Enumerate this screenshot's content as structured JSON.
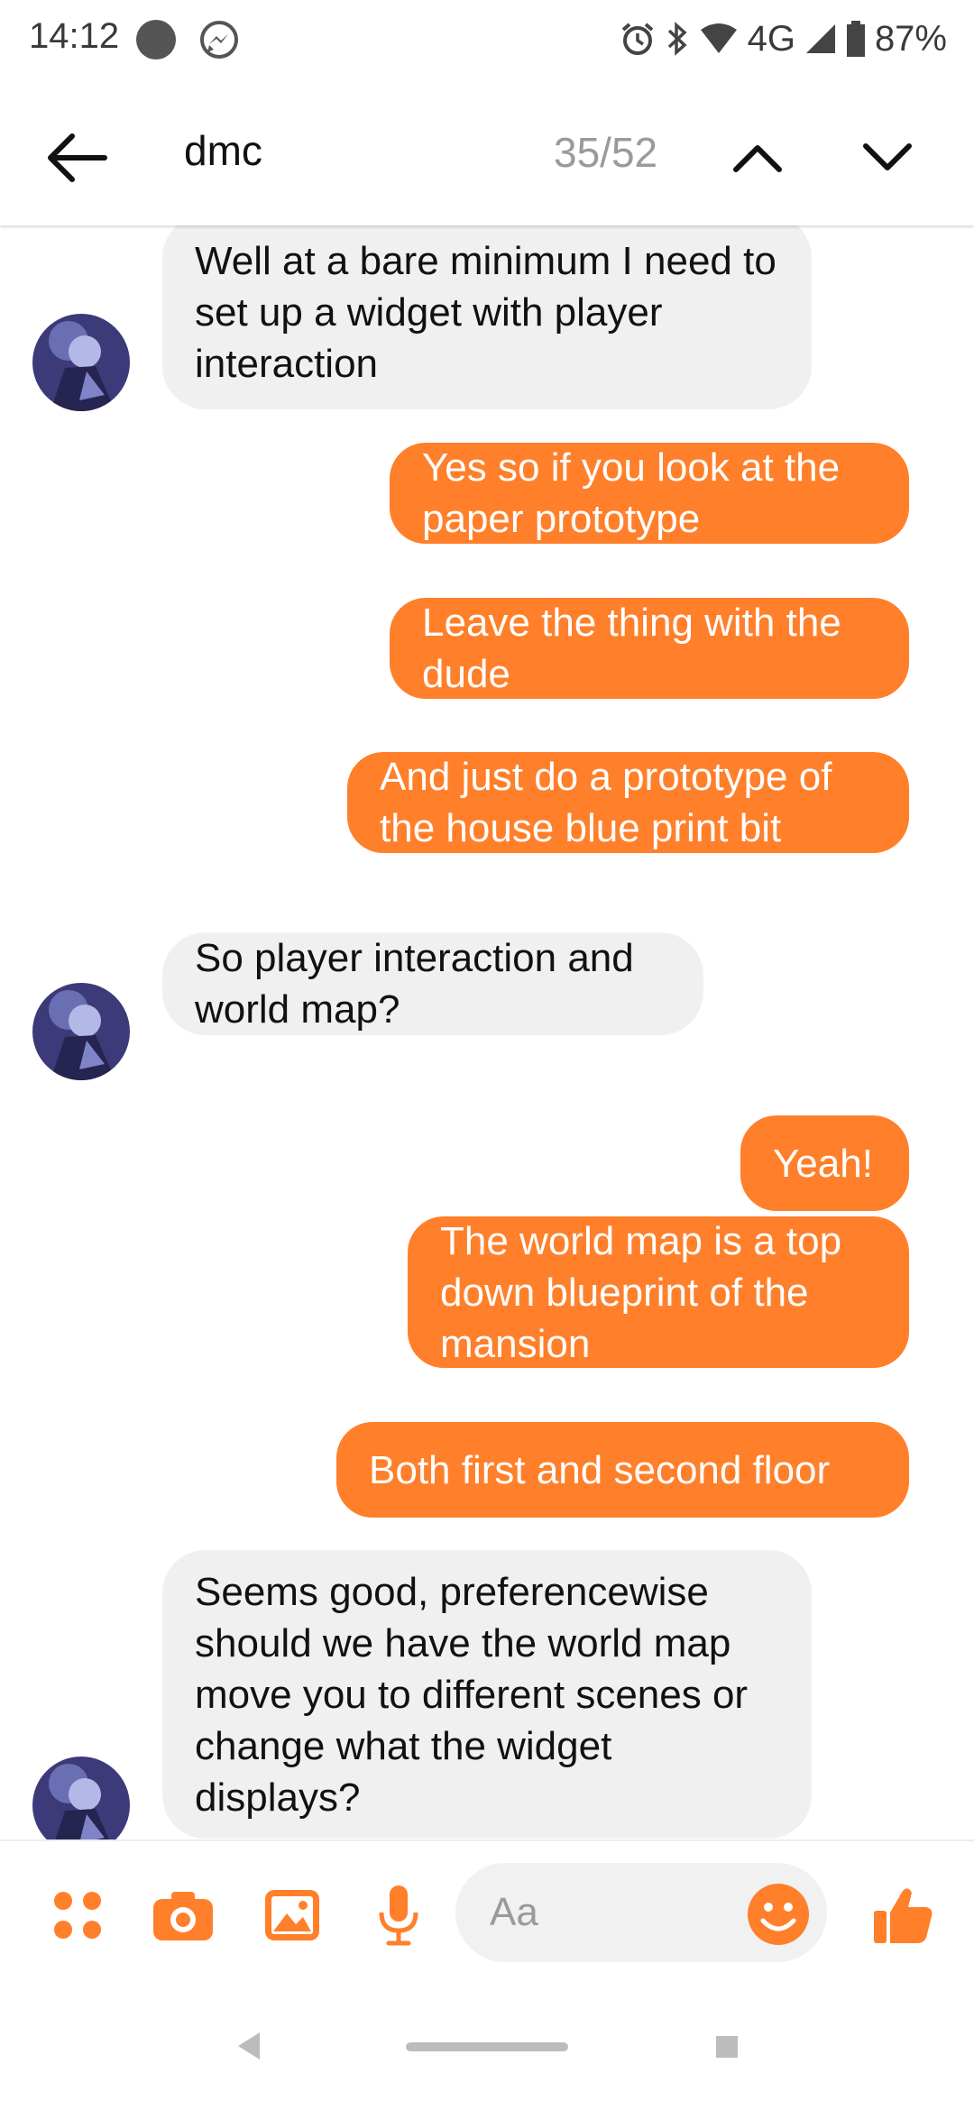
{
  "status_bar": {
    "time": "14:12",
    "network": "4G",
    "battery": "87%",
    "icons": [
      "notification-dot-icon",
      "messenger-icon",
      "alarm-icon",
      "bluetooth-icon",
      "wifi-icon",
      "signal-icon",
      "battery-icon"
    ]
  },
  "search": {
    "query": "dmc",
    "match_count": "35/52",
    "icons": [
      "back-arrow-icon",
      "chevron-up-icon",
      "chevron-down-icon"
    ]
  },
  "messages": [
    {
      "side": "incoming",
      "text": "Well at a bare minimum I need to set up a widget with player interaction"
    },
    {
      "side": "outgoing",
      "text": "Yes so if you look at the paper prototype"
    },
    {
      "side": "outgoing",
      "text": "Leave the thing with the dude"
    },
    {
      "side": "outgoing",
      "text": "And just do a prototype of the house blue print bit"
    },
    {
      "side": "incoming",
      "text": "So player interaction and world map?"
    },
    {
      "side": "outgoing",
      "text": "Yeah!"
    },
    {
      "side": "outgoing",
      "text": "The world map is a top down blueprint of the mansion"
    },
    {
      "side": "outgoing",
      "text": "Both first and second floor"
    },
    {
      "side": "incoming",
      "text": "Seems good, preferencewise should we have the world map move you to different scenes or  change what the widget displays?"
    }
  ],
  "composer": {
    "placeholder": "Aa",
    "icons": [
      "grid-dots-icon",
      "camera-icon",
      "image-icon",
      "microphone-icon",
      "emoji-icon",
      "thumbs-up-icon"
    ]
  },
  "colors": {
    "accent": "#ff7f2a",
    "incoming_bubble": "#f0f0f0",
    "outgoing_bubble": "#ff7f2a"
  }
}
